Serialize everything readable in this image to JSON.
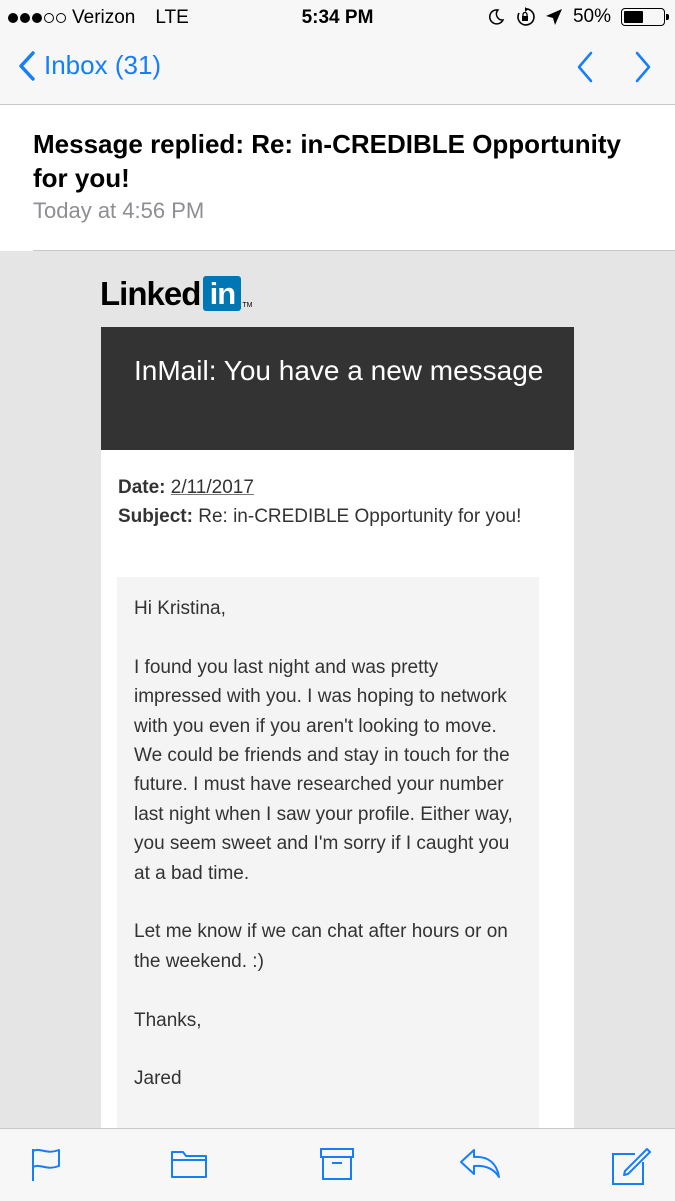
{
  "status_bar": {
    "carrier": "Verizon",
    "network": "LTE",
    "time": "5:34 PM",
    "battery": "50%",
    "battery_level": 0.5,
    "signal_bars_filled": 3,
    "signal_bars_total": 5,
    "icons": [
      "moon-icon",
      "rotation-lock-icon",
      "location-arrow-icon",
      "battery-icon"
    ]
  },
  "nav": {
    "back_label": "Inbox (31)",
    "icons": [
      "back-chevron-icon",
      "previous-message-icon",
      "next-message-icon"
    ]
  },
  "header": {
    "subject": "Message replied: Re: in-CREDIBLE Opportunity for you!",
    "date": "Today at 4:56 PM"
  },
  "email": {
    "logo_text": "Linked",
    "logo_in": "in",
    "logo_tm": "TM",
    "card_title": "InMail: You have a new message",
    "date_label": "Date:",
    "date_value": "2/11/2017",
    "subject_label": "Subject:",
    "subject_value": "Re: in-CREDIBLE Opportunity for you!",
    "greeting": "Hi Kristina,",
    "paragraph1": "I found you last night and was pretty impressed with you. I was hoping to network with you even if you aren't looking to move. We could be friends and stay in touch for the future. I must have researched your number last night when I saw your profile. Either way, you seem sweet and I'm sorry if I caught you at a bad time.",
    "paragraph2": "Let me know if we can chat after hours or on the weekend. :)",
    "closing": "Thanks,",
    "signature": "Jared"
  },
  "toolbar": {
    "icons": [
      "flag-icon",
      "folder-icon",
      "archive-icon",
      "reply-icon",
      "compose-icon"
    ]
  },
  "colors": {
    "accent": "#147efb",
    "linkedin_blue": "#0077b5",
    "card_header": "#333333",
    "email_bg": "#e5e5e5"
  }
}
